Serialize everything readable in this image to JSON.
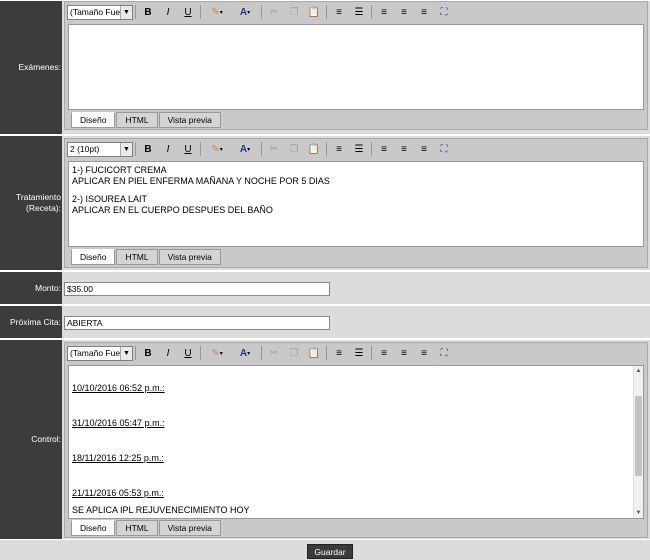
{
  "fields": {
    "examenes": {
      "label": "Exámenes:"
    },
    "tratamiento": {
      "label": "Tratamiento (Receta):",
      "font_size_value": "2 (10pt)",
      "lines": [
        "1-) FUCICORT CREMA",
        "APLICAR EN PIEL ENFERMA MAÑANA Y NOCHE POR 5 DIAS",
        "2-) ISOUREA LAIT",
        "APLICAR EN EL CUERPO DESPUES DEL BAÑO"
      ]
    },
    "monto": {
      "label": "Monto:",
      "value": "$35.00"
    },
    "proxima": {
      "label": "Próxima Cita:",
      "value": "ABIERTA"
    },
    "control": {
      "label": "Control:",
      "entries": [
        "10/10/2016 06:52 p.m.:",
        "31/10/2016 05:47 p.m.:",
        "18/11/2016 12:25 p.m.:",
        "21/11/2016 05:53 p.m.:"
      ],
      "last_note": "SE APLICA IPL REJUVENECIMIENTO HOY"
    }
  },
  "toolbar": {
    "font_size_placeholder": "(Tamaño Fuente)",
    "bold": "B",
    "italic": "I",
    "underline": "U",
    "font_color": "A"
  },
  "tabs": {
    "design": "Diseño",
    "html": "HTML",
    "preview": "Vista previa"
  },
  "footer": {
    "save_label": "Guardar"
  }
}
